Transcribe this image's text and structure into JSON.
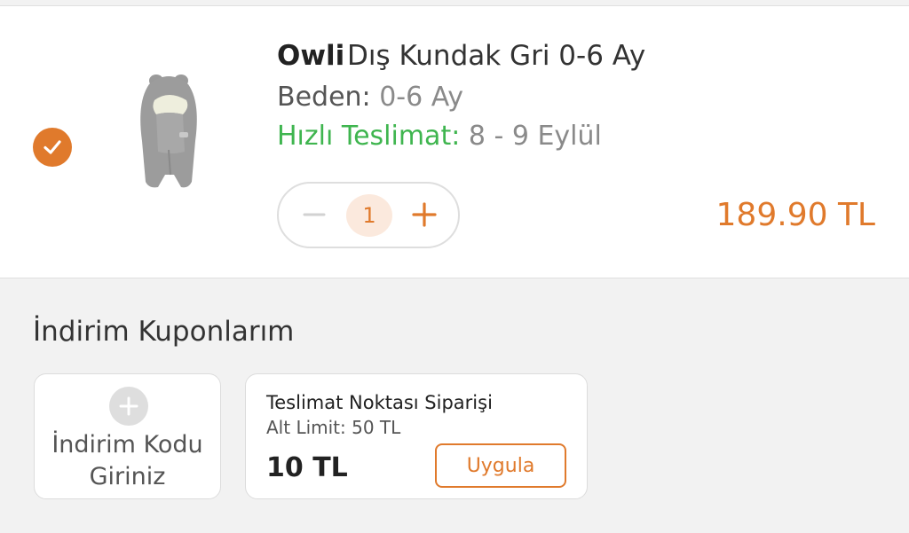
{
  "colors": {
    "accent": "#e07a2c",
    "delivery_green": "#3fb54f",
    "page_background": "#f2f2f2"
  },
  "product": {
    "brand": "Owli",
    "name": "Dış Kundak Gri 0-6 Ay",
    "size_label": "Beden:",
    "size_value": "0-6 Ay",
    "delivery_label": "Hızlı Teslimat:",
    "delivery_value": "8 - 9 Eylül",
    "selected": true,
    "quantity": "1",
    "price": "189.90 TL",
    "icons": {
      "selected": "check-icon",
      "decrease": "minus-icon",
      "increase": "plus-icon"
    }
  },
  "coupons": {
    "title": "İndirim Kuponlarım",
    "enter_code_label": "İndirim Kodu Giriniz",
    "add_icon": "plus-circle-icon",
    "items": [
      {
        "name": "Teslimat Noktası Siparişi",
        "limit": "Alt Limit: 50 TL",
        "amount": "10 TL",
        "apply_label": "Uygula"
      }
    ]
  }
}
